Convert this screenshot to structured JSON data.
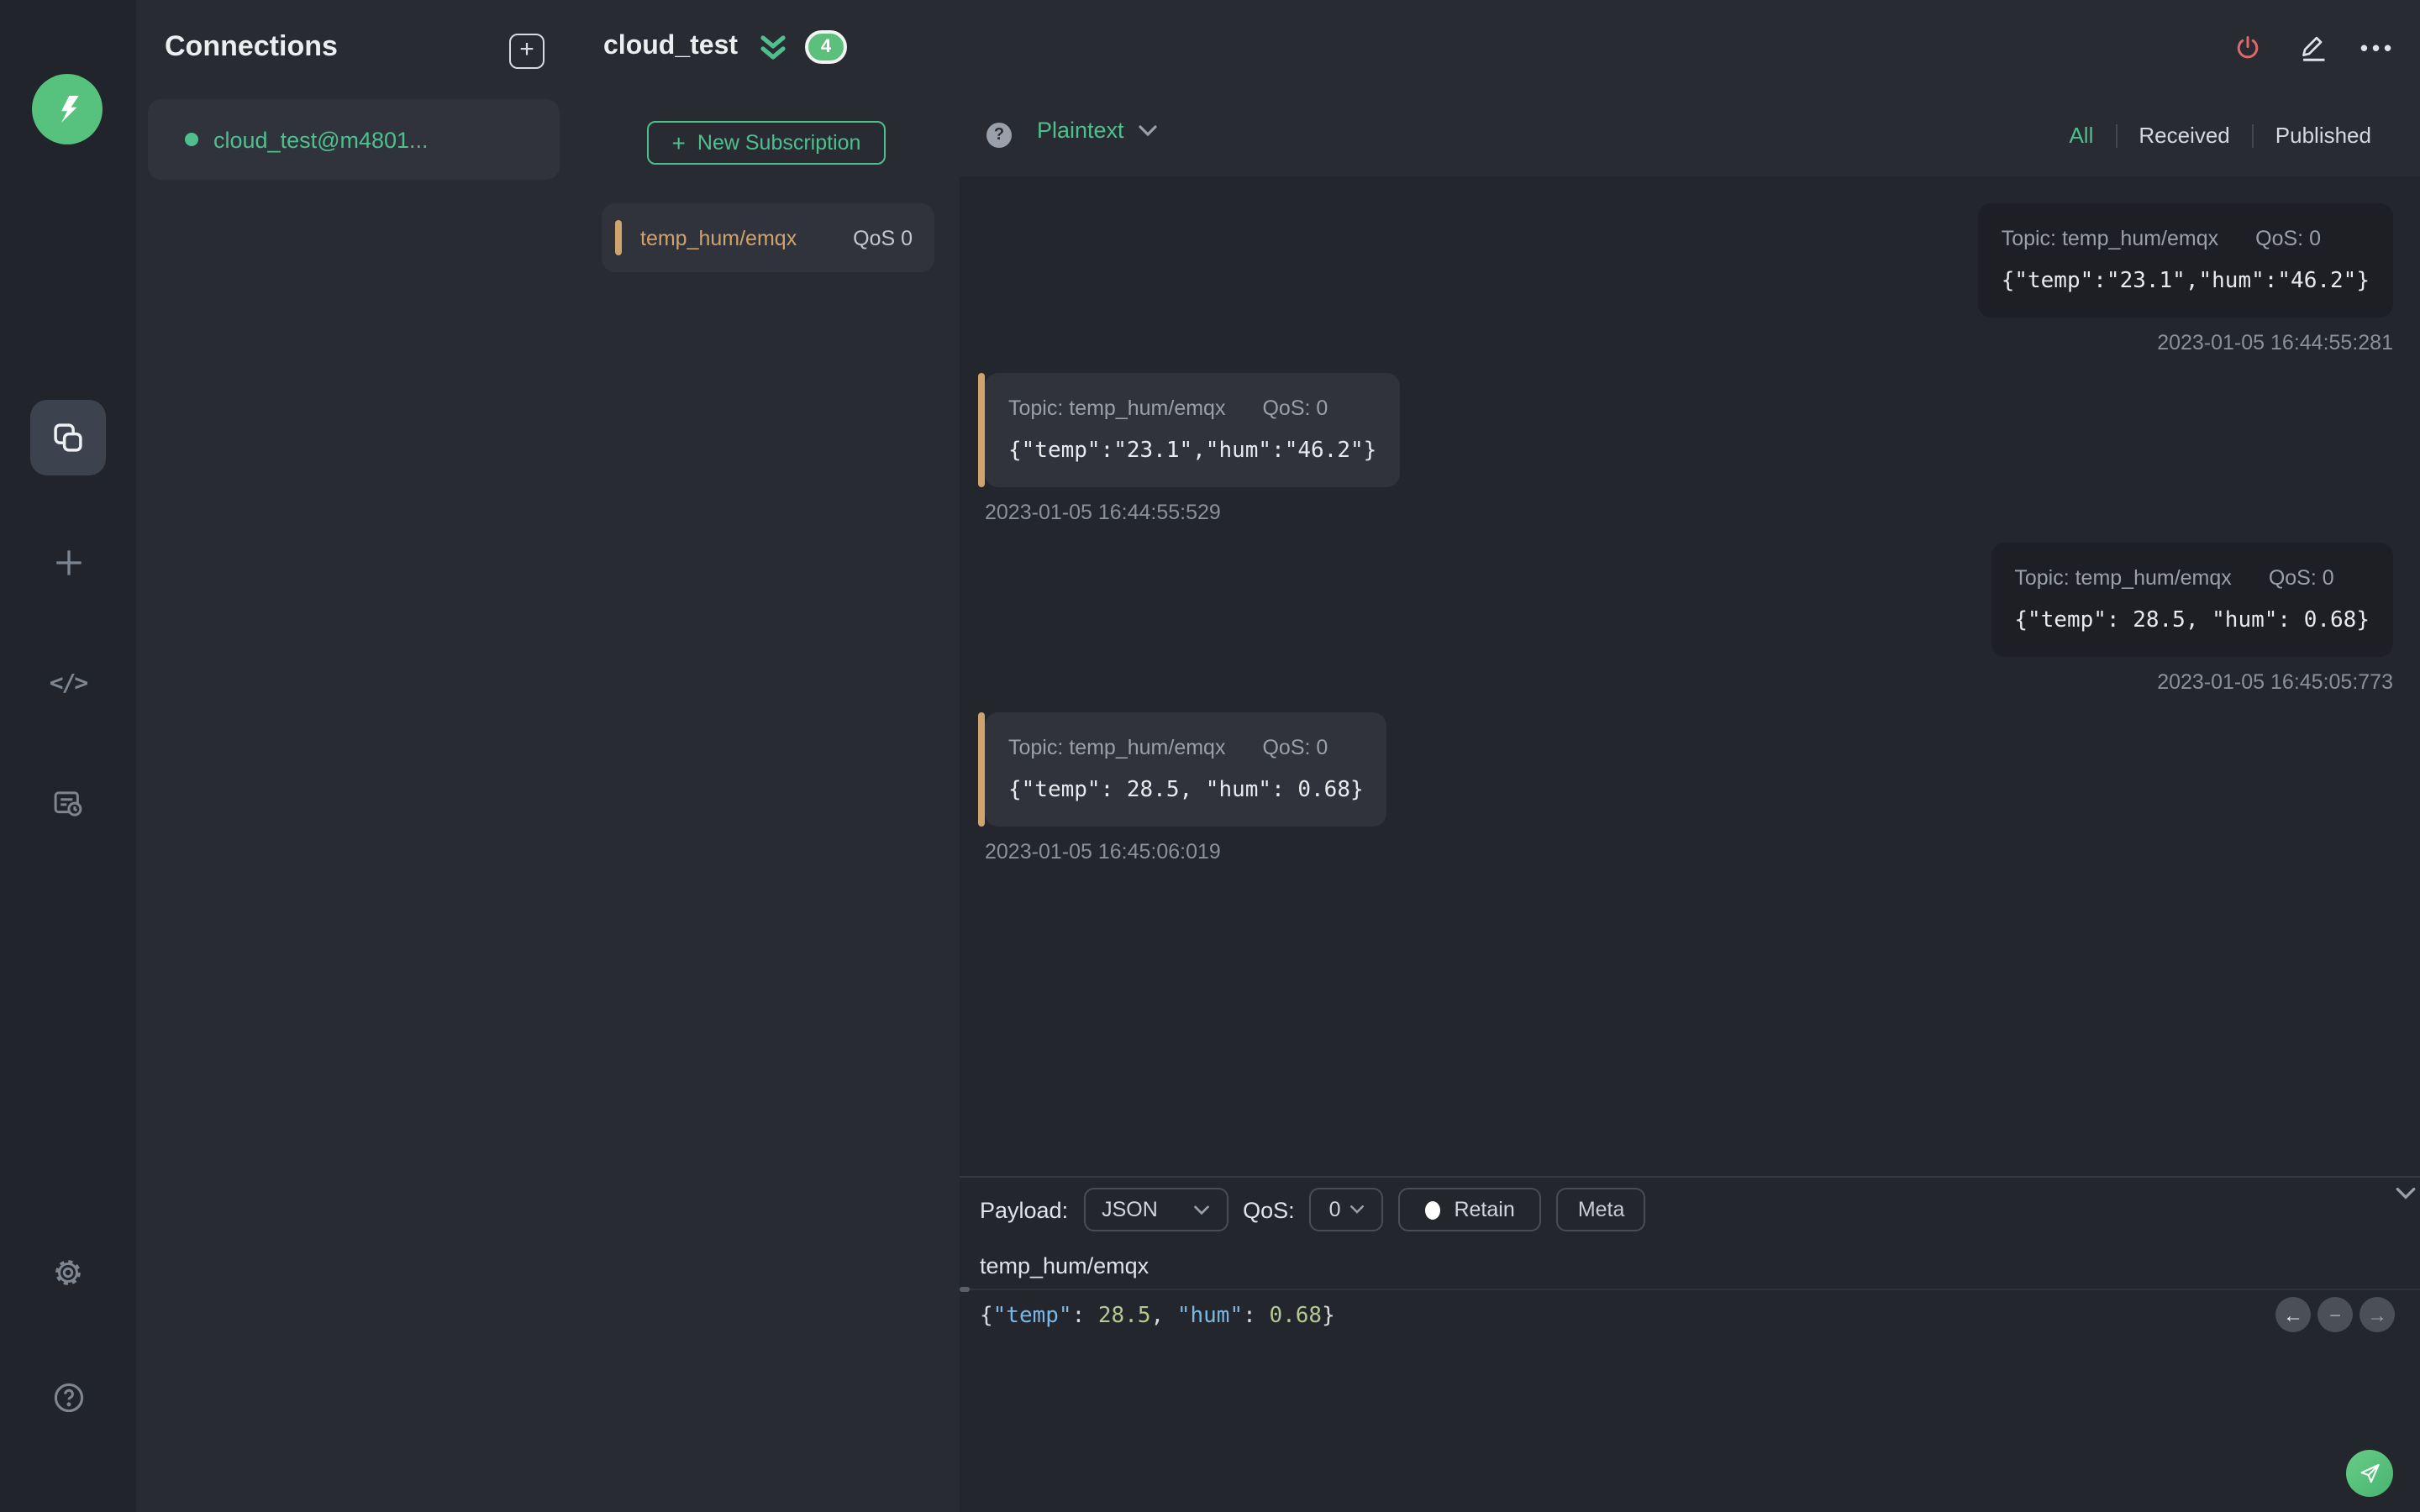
{
  "colors": {
    "accent_green": "#4fc08d",
    "badge_green": "#5cc07c",
    "topic_orange": "#cfa46c",
    "disconnect_red": "#e0686b",
    "panel_bg": "#292b33",
    "content_bg": "#24262d",
    "received_card_bg": "#30333c",
    "published_card_bg": "#1d1f25",
    "syntax_key": "#7cb8e4",
    "syntax_number": "#b3c893",
    "syntax_punct": "#d8dade"
  },
  "sidebar": {
    "items": [
      {
        "name": "connections",
        "icon": "connections-icon",
        "active": true
      },
      {
        "name": "new-connection",
        "icon": "plus-icon",
        "active": false
      },
      {
        "name": "script",
        "icon": "script-icon",
        "active": false
      },
      {
        "name": "log",
        "icon": "log-icon",
        "active": false
      },
      {
        "name": "settings",
        "icon": "gear-icon",
        "active": false
      },
      {
        "name": "help",
        "icon": "help-icon",
        "active": false
      }
    ],
    "script_glyph": "</>"
  },
  "connections": {
    "title": "Connections",
    "add_button": "+",
    "items": [
      {
        "name": "cloud_test@m4801...",
        "connected": true
      }
    ]
  },
  "header": {
    "title": "cloud_test",
    "unread_badge": "4"
  },
  "subscriptions": {
    "new_button": "New Subscription",
    "new_button_plus": "+",
    "items": [
      {
        "topic": "temp_hum/emqx",
        "qos": "QoS 0"
      }
    ]
  },
  "messages": {
    "help_glyph": "?",
    "format_selected": "Plaintext",
    "filters": [
      {
        "label": "All",
        "active": true
      },
      {
        "label": "Received",
        "active": false
      },
      {
        "label": "Published",
        "active": false
      }
    ],
    "items": [
      {
        "direction": "published",
        "topic_label": "Topic: temp_hum/emqx",
        "qos_label": "QoS: 0",
        "payload": "{\"temp\":\"23.1\",\"hum\":\"46.2\"}",
        "timestamp": "2023-01-05 16:44:55:281"
      },
      {
        "direction": "received",
        "topic_label": "Topic: temp_hum/emqx",
        "qos_label": "QoS: 0",
        "payload": "{\"temp\":\"23.1\",\"hum\":\"46.2\"}",
        "timestamp": "2023-01-05 16:44:55:529"
      },
      {
        "direction": "published",
        "topic_label": "Topic: temp_hum/emqx",
        "qos_label": "QoS: 0",
        "payload": "{\"temp\": 28.5, \"hum\": 0.68}",
        "timestamp": "2023-01-05 16:45:05:773"
      },
      {
        "direction": "received",
        "topic_label": "Topic: temp_hum/emqx",
        "qos_label": "QoS: 0",
        "payload": "{\"temp\": 28.5, \"hum\": 0.68}",
        "timestamp": "2023-01-05 16:45:06:019"
      }
    ]
  },
  "publish": {
    "payload_label": "Payload:",
    "payload_format": "JSON",
    "qos_label": "QoS:",
    "qos_value": "0",
    "retain_label": "Retain",
    "meta_label": "Meta",
    "topic_value": "temp_hum/emqx",
    "editor_tokens": [
      {
        "text": "{",
        "type": "punct"
      },
      {
        "text": "\"temp\"",
        "type": "key"
      },
      {
        "text": ": ",
        "type": "punct"
      },
      {
        "text": "28.5",
        "type": "num"
      },
      {
        "text": ", ",
        "type": "punct"
      },
      {
        "text": "\"hum\"",
        "type": "key"
      },
      {
        "text": ": ",
        "type": "punct"
      },
      {
        "text": "0.68",
        "type": "num"
      },
      {
        "text": "}",
        "type": "punct"
      }
    ],
    "nav": {
      "prev": "←",
      "collapse_all": "−",
      "next": "→"
    }
  }
}
